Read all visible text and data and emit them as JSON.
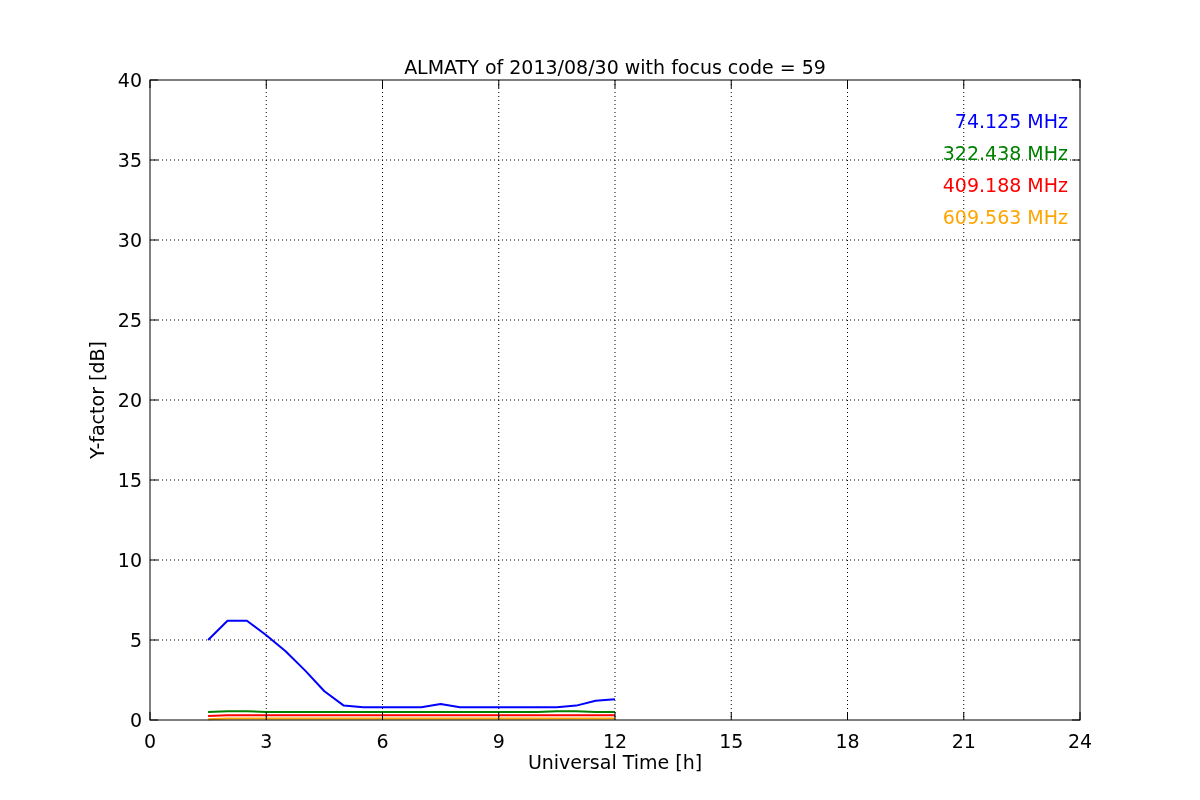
{
  "chart_data": {
    "type": "line",
    "title": "ALMATY of 2013/08/30 with focus code = 59",
    "xlabel": "Universal Time [h]",
    "ylabel": "Y-factor [dB]",
    "x": [
      1.5,
      2,
      2.5,
      3,
      3.5,
      4,
      4.5,
      5,
      5.5,
      6,
      6.5,
      7,
      7.5,
      8,
      8.5,
      9,
      9.5,
      10,
      10.5,
      11,
      11.5,
      12
    ],
    "series": [
      {
        "name": "74.125 MHz",
        "color": "#0000ff",
        "values": [
          5.0,
          6.2,
          6.2,
          5.3,
          4.3,
          3.1,
          1.8,
          0.9,
          0.8,
          0.8,
          0.8,
          0.8,
          1.0,
          0.8,
          0.8,
          0.8,
          0.8,
          0.8,
          0.8,
          0.9,
          1.2,
          1.3
        ]
      },
      {
        "name": "322.438 MHz",
        "color": "#008000",
        "values": [
          0.5,
          0.55,
          0.55,
          0.5,
          0.5,
          0.5,
          0.5,
          0.5,
          0.5,
          0.5,
          0.5,
          0.5,
          0.5,
          0.5,
          0.5,
          0.5,
          0.5,
          0.5,
          0.55,
          0.55,
          0.5,
          0.5
        ]
      },
      {
        "name": "409.188 MHz",
        "color": "#ff0000",
        "values": [
          0.25,
          0.3,
          0.3,
          0.3,
          0.3,
          0.3,
          0.3,
          0.3,
          0.3,
          0.3,
          0.3,
          0.3,
          0.3,
          0.3,
          0.3,
          0.3,
          0.3,
          0.3,
          0.3,
          0.3,
          0.3,
          0.3
        ]
      },
      {
        "name": "609.563 MHz",
        "color": "#ffa500",
        "values": [
          0.05,
          0.1,
          0.1,
          0.1,
          0.1,
          0.1,
          0.1,
          0.1,
          0.1,
          0.1,
          0.1,
          0.1,
          0.1,
          0.1,
          0.1,
          0.1,
          0.1,
          0.1,
          0.1,
          0.1,
          0.1,
          0.1
        ]
      }
    ],
    "grid": true,
    "xlim": [
      0,
      24
    ],
    "ylim": [
      0,
      40
    ],
    "xticks": [
      0,
      3,
      6,
      9,
      12,
      15,
      18,
      21,
      24
    ],
    "yticks": [
      0,
      5,
      10,
      15,
      20,
      25,
      30,
      35,
      40
    ]
  }
}
